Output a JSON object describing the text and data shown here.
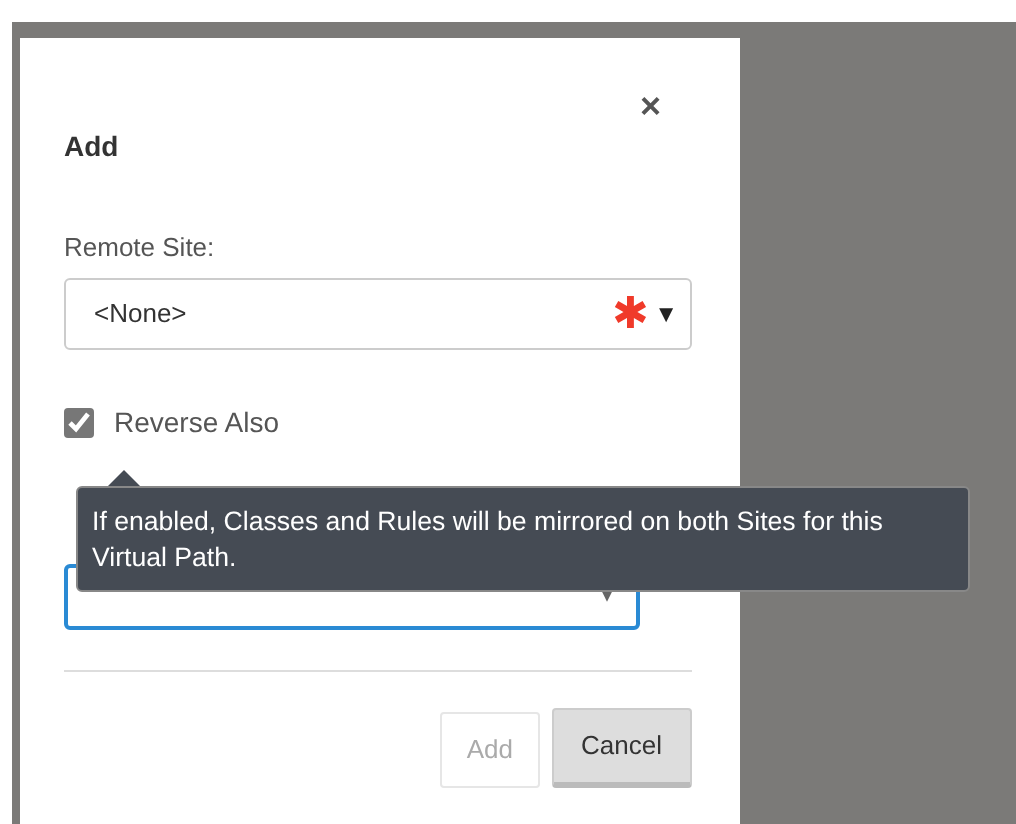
{
  "dialog": {
    "title": "Add",
    "close": "×",
    "remote_site": {
      "label": "Remote Site:",
      "value": "<None>",
      "required_mark": "✱",
      "caret": "▼"
    },
    "reverse_also": {
      "label": "Reverse Also",
      "checked": true
    },
    "tooltip": "If enabled, Classes and Rules will be mirrored on both Sites for this Virtual Path.",
    "second_select": {
      "caret": "▾",
      "focused": true
    },
    "buttons": [
      {
        "label": "Add",
        "disabled": true
      },
      {
        "label": "Cancel",
        "disabled": false
      }
    ]
  }
}
